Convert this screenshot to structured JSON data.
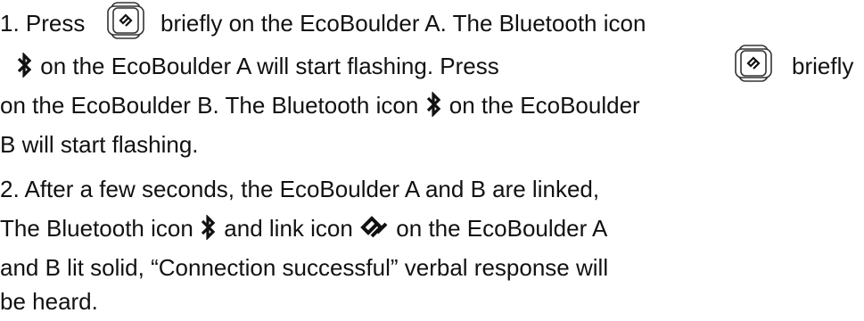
{
  "step1": {
    "a": "1. Press",
    "b": "briefly on the EcoBoulder A. The Bluetooth icon",
    "c": "on the EcoBoulder A will start flashing. Press",
    "d": "briefly",
    "e": "on the EcoBoulder B. The Bluetooth icon",
    "f": "on the EcoBoulder",
    "g": "B will start flashing."
  },
  "step2": {
    "a": "2. After a few seconds, the  EcoBoulder A and B are linked,",
    "b": "The Bluetooth icon",
    "c": "and link icon",
    "d": "on the EcoBoulder A",
    "e": "and B lit solid, “Connection successful” verbal response will",
    "f": "be heard."
  },
  "icons": [
    "link-button-icon",
    "bluetooth-icon",
    "link-icon"
  ]
}
